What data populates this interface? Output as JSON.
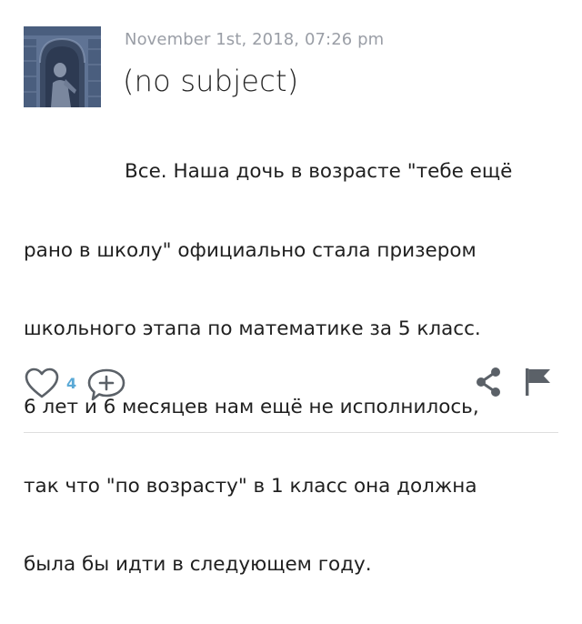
{
  "post": {
    "date": "November 1st, 2018, 07:26 pm",
    "subject": "(no subject)",
    "body_lines": [
      "Все. Наша дочь в возрасте \"тебе ещё",
      "рано в школу\" официально стала призером",
      "школьного этапа по математике за 5 класс.",
      "6 лет и 6 месяцев нам ещё не исполнилось,",
      "так что \"по возрасту\" в 1 класс она должна",
      "была бы идти в следующем году."
    ]
  },
  "actions": {
    "like_count": "4",
    "icons": {
      "like": "heart-icon",
      "comment": "add-comment-icon",
      "share": "share-icon",
      "flag": "flag-icon"
    }
  },
  "colors": {
    "date_text": "#9a9ea6",
    "icon": "#5b6168",
    "like_count": "#5aa9d6",
    "divider": "#dedede"
  }
}
